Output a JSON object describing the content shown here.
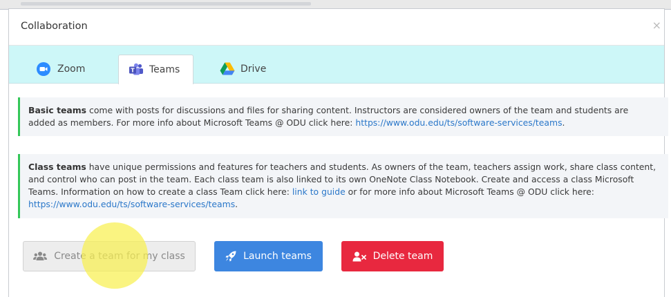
{
  "modal": {
    "title": "Collaboration",
    "close_label": "×"
  },
  "tabs": [
    {
      "label": "Zoom",
      "icon": "zoom-icon",
      "active": false
    },
    {
      "label": "Teams",
      "icon": "teams-icon",
      "active": true
    },
    {
      "label": "Drive",
      "icon": "drive-icon",
      "active": false
    }
  ],
  "info": {
    "basic": {
      "bold": "Basic teams",
      "text": " come with posts for discussions and files for sharing content. Instructors are considered owners of the team and students are added as members. For more info about Microsoft Teams @ ODU click here: ",
      "link": "https://www.odu.edu/ts/software-services/teams",
      "end": "."
    },
    "class": {
      "bold": "Class teams",
      "text": " have unique permissions and features for teachers and students. As owners of the team, teachers assign work, share class content, and control who can post in the team. Each class team is also linked to its own OneNote Class Notebook. Create and access a class Microsoft Teams. Information on how to create a class Team click here: ",
      "guide_link": "link to guide",
      "text2": " or for more info about Microsoft Teams @ ODU click here: ",
      "link": "https://www.odu.edu/ts/software-services/teams",
      "end": "."
    }
  },
  "buttons": {
    "create": {
      "label": "Create a team for my class",
      "icon": "users-icon"
    },
    "launch": {
      "label": "Launch teams",
      "icon": "rocket-icon"
    },
    "delete": {
      "label": "Delete team",
      "icon": "user-times-icon"
    }
  },
  "colors": {
    "tabbar_bg": "#cdf7f8",
    "alert_accent": "#34c759",
    "launch_bg": "#3d86e0",
    "delete_bg": "#e8283f",
    "link": "#2a77c9"
  }
}
